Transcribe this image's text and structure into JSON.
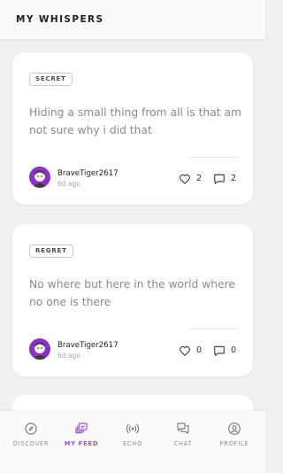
{
  "header": {
    "title": "MY WHISPERS"
  },
  "posts": [
    {
      "tag": "SECRET",
      "text": "Hiding a small thing from all is that am not sure why i did that",
      "username": "BraveTiger2617",
      "time_ago": "6d ago",
      "likes": "2",
      "comments": "2"
    },
    {
      "tag": "REGRET",
      "text": "No where but here in the world where no one is there",
      "username": "BraveTiger2617",
      "time_ago": "6d ago",
      "likes": "0",
      "comments": "0"
    }
  ],
  "nav": {
    "items": [
      {
        "label": "DISCOVER",
        "icon": "compass-icon"
      },
      {
        "label": "MY FEED",
        "icon": "feed-icon",
        "active": true
      },
      {
        "label": "ECHO",
        "icon": "broadcast-icon"
      },
      {
        "label": "CHAT",
        "icon": "chat-icon"
      },
      {
        "label": "PROFILE",
        "icon": "profile-icon"
      }
    ]
  },
  "colors": {
    "accent": "#9b4de0",
    "avatar_bg": "#8b2fc9",
    "background": "#f1f1f3"
  }
}
